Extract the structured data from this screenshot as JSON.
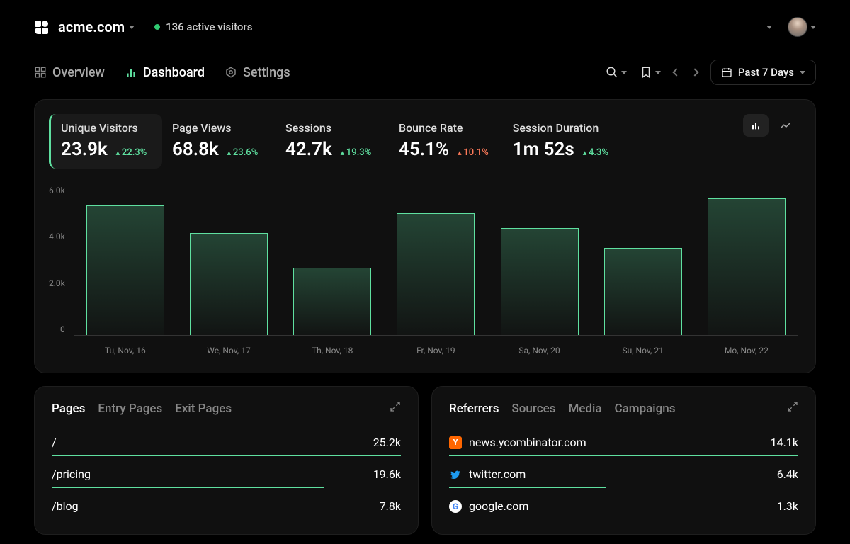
{
  "header": {
    "site": "acme.com",
    "active_visitors_text": "136 active visitors"
  },
  "nav": {
    "items": [
      {
        "label": "Overview"
      },
      {
        "label": "Dashboard"
      },
      {
        "label": "Settings"
      }
    ],
    "date_range": "Past 7 Days"
  },
  "metrics": [
    {
      "label": "Unique Visitors",
      "value": "23.9k",
      "delta": "22.3%",
      "dir": "up",
      "active": true
    },
    {
      "label": "Page Views",
      "value": "68.8k",
      "delta": "23.6%",
      "dir": "up"
    },
    {
      "label": "Sessions",
      "value": "42.7k",
      "delta": "19.3%",
      "dir": "up"
    },
    {
      "label": "Bounce Rate",
      "value": "45.1%",
      "delta": "10.1%",
      "dir": "down"
    },
    {
      "label": "Session Duration",
      "value": "1m 52s",
      "delta": "4.3%",
      "dir": "up"
    }
  ],
  "chart_data": {
    "type": "bar",
    "title": "Unique Visitors",
    "ylabel": "",
    "categories": [
      "Tu, Nov, 16",
      "We, Nov, 17",
      "Th, Nov, 18",
      "Fr, Nov, 19",
      "Sa, Nov, 20",
      "Su, Nov, 21",
      "Mo, Nov, 22"
    ],
    "values": [
      5200,
      4100,
      2700,
      4900,
      4300,
      3500,
      5500
    ],
    "ylim": [
      0,
      6000
    ],
    "y_ticks": [
      "6.0k",
      "4.0k",
      "2.0k",
      "0"
    ]
  },
  "pages_card": {
    "tabs": [
      "Pages",
      "Entry Pages",
      "Exit Pages"
    ],
    "rows": [
      {
        "path": "/",
        "value": "25.2k",
        "bar": 100
      },
      {
        "path": "/pricing",
        "value": "19.6k",
        "bar": 78
      },
      {
        "path": "/blog",
        "value": "7.8k",
        "bar": 0
      }
    ]
  },
  "referrers_card": {
    "tabs": [
      "Referrers",
      "Sources",
      "Media",
      "Campaigns"
    ],
    "rows": [
      {
        "name": "news.ycombinator.com",
        "value": "14.1k",
        "bar": 100,
        "fav": "yc"
      },
      {
        "name": "twitter.com",
        "value": "6.4k",
        "bar": 45,
        "fav": "tw"
      },
      {
        "name": "google.com",
        "value": "1.3k",
        "bar": 0,
        "fav": "g"
      }
    ]
  }
}
